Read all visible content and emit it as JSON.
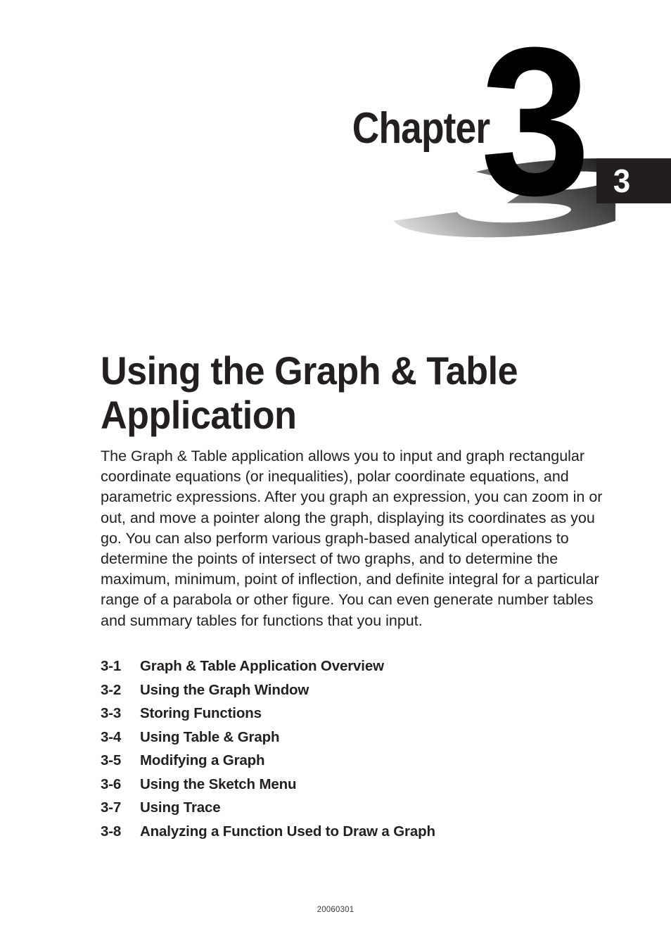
{
  "masthead": {
    "chapter_word": "Chapter",
    "chapter_number": "3",
    "edge_tab_number": "3",
    "tab_color": "#231f20",
    "numeral_color": "#000000",
    "shadow_gradient_from": "#000000",
    "shadow_gradient_to": "#ffffff"
  },
  "content": {
    "title": "Using the Graph & Table Application",
    "intro_paragraph": "The Graph & Table application allows you to input and graph rectangular coordinate equations (or inequalities), polar coordinate equations, and parametric expressions. After you graph an expression, you can zoom in or out, and move a pointer along the graph, displaying its coordinates as you go. You can also perform various graph-based analytical operations to determine the points of intersect of two graphs, and to determine the maximum, minimum, point of inflection, and definite integral for a particular range of a parabola or other figure. You can even generate number tables and summary tables for functions that you input."
  },
  "sections": [
    {
      "number": "3-1",
      "label": "Graph & Table Application Overview"
    },
    {
      "number": "3-2",
      "label": "Using the Graph Window"
    },
    {
      "number": "3-3",
      "label": "Storing Functions"
    },
    {
      "number": "3-4",
      "label": "Using Table & Graph"
    },
    {
      "number": "3-5",
      "label": "Modifying a Graph"
    },
    {
      "number": "3-6",
      "label": "Using the Sketch Menu"
    },
    {
      "number": "3-7",
      "label": "Using Trace"
    },
    {
      "number": "3-8",
      "label": "Analyzing a Function Used to Draw a Graph"
    }
  ],
  "footer": {
    "code": "20060301"
  }
}
